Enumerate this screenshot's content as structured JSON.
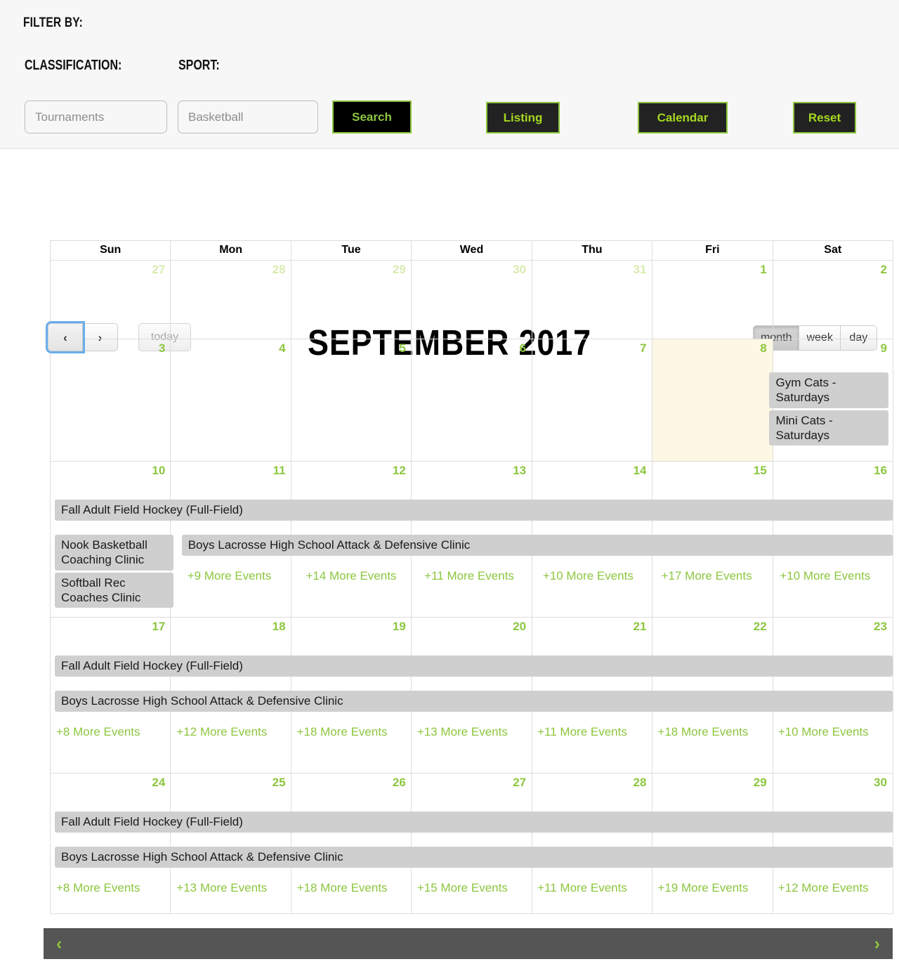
{
  "filter": {
    "heading": "FILTER BY:",
    "classification_label": "CLASSIFICATION:",
    "sport_label": "SPORT:",
    "classification_value": "",
    "classification_placeholder": "Tournaments",
    "sport_value": "",
    "sport_placeholder": "Basketball",
    "search_label": "Search",
    "listing_label": "Listing",
    "calendar_label": "Calendar",
    "reset_label": "Reset",
    "accent_green": "#8dc63f",
    "button_black": "#000000",
    "button_dark": "#222222"
  },
  "toolbar": {
    "prev_label": "‹",
    "next_label": "›",
    "today_label": "today",
    "title": "SEPTEMBER 2017",
    "views": [
      {
        "label": "month",
        "active": true
      },
      {
        "label": "week",
        "active": false
      },
      {
        "label": "day",
        "active": false
      }
    ]
  },
  "calendar": {
    "day_headers": [
      "Sun",
      "Mon",
      "Tue",
      "Wed",
      "Thu",
      "Fri",
      "Sat"
    ],
    "today_color": "#fcf8e3",
    "event_pill_color": "#cfcfcf",
    "weeks": [
      {
        "days": [
          {
            "n": "27",
            "other": true
          },
          {
            "n": "28",
            "other": true
          },
          {
            "n": "29",
            "other": true
          },
          {
            "n": "30",
            "other": true
          },
          {
            "n": "31",
            "other": true
          },
          {
            "n": "1",
            "other": false
          },
          {
            "n": "2",
            "other": false
          }
        ]
      },
      {
        "days": [
          {
            "n": "3",
            "other": false
          },
          {
            "n": "4",
            "other": false
          },
          {
            "n": "5",
            "other": false
          },
          {
            "n": "6",
            "other": false
          },
          {
            "n": "7",
            "other": false
          },
          {
            "n": "8",
            "other": false,
            "today": true
          },
          {
            "n": "9",
            "other": false
          }
        ],
        "sat_events": [
          "Gym Cats - Saturdays",
          "Mini Cats - Saturdays"
        ]
      },
      {
        "days": [
          {
            "n": "10",
            "other": false
          },
          {
            "n": "11",
            "other": false
          },
          {
            "n": "12",
            "other": false
          },
          {
            "n": "13",
            "other": false
          },
          {
            "n": "14",
            "other": false
          },
          {
            "n": "15",
            "other": false
          },
          {
            "n": "16",
            "other": false
          }
        ],
        "span_full": "Fall Adult Field Hockey (Full-Field)",
        "sun_events": [
          "Nook Basketball Coaching Clinic",
          "Softball Rec Coaches Clinic"
        ],
        "span_mon_sat": "Boys Lacrosse High School Attack & Defensive Clinic",
        "more": [
          "",
          "+9 More Events",
          "+14 More Events",
          "+11 More Events",
          "+10 More Events",
          "+17 More Events",
          "+10 More Events"
        ]
      },
      {
        "days": [
          {
            "n": "17",
            "other": false
          },
          {
            "n": "18",
            "other": false
          },
          {
            "n": "19",
            "other": false
          },
          {
            "n": "20",
            "other": false
          },
          {
            "n": "21",
            "other": false
          },
          {
            "n": "22",
            "other": false
          },
          {
            "n": "23",
            "other": false
          }
        ],
        "span_full": "Fall Adult Field Hockey (Full-Field)",
        "span_full2": "Boys Lacrosse High School Attack & Defensive Clinic",
        "more": [
          "+8 More Events",
          "+12 More Events",
          "+18 More Events",
          "+13 More Events",
          "+11 More Events",
          "+18 More Events",
          "+10 More Events"
        ]
      },
      {
        "days": [
          {
            "n": "24",
            "other": false
          },
          {
            "n": "25",
            "other": false
          },
          {
            "n": "26",
            "other": false
          },
          {
            "n": "27",
            "other": false
          },
          {
            "n": "28",
            "other": false
          },
          {
            "n": "29",
            "other": false
          },
          {
            "n": "30",
            "other": false
          }
        ],
        "span_full": "Fall Adult Field Hockey (Full-Field)",
        "span_full2": "Boys Lacrosse High School Attack & Defensive Clinic",
        "more": [
          "+8 More Events",
          "+13 More Events",
          "+18 More Events",
          "+15 More Events",
          "+11 More Events",
          "+19 More Events",
          "+12 More Events"
        ]
      }
    ]
  },
  "bottom": {
    "prev_label": "‹",
    "next_label": "›",
    "bar_color": "#555555"
  }
}
